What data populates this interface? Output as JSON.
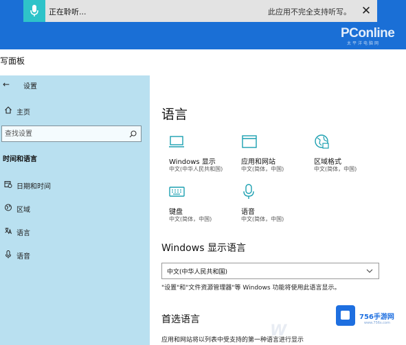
{
  "dictation": {
    "status": "正在聆听...",
    "notice": "此应用不完全支持听写。",
    "close_symbol": "✕"
  },
  "watermark": {
    "logo": "PConline",
    "logo_sub": "太平洋电脑网",
    "site": "756手游网",
    "site_sub": "www.756s.com"
  },
  "handwriting_panel_title": "写面板",
  "sidebar": {
    "back_symbol": "←",
    "title": "设置",
    "home_label": "主页",
    "search_placeholder": "查找设置",
    "section_heading": "时间和语言",
    "items": [
      {
        "label": "日期和时间",
        "icon": "calendar-clock-icon"
      },
      {
        "label": "区域",
        "icon": "globe-icon"
      },
      {
        "label": "语言",
        "icon": "language-icon"
      },
      {
        "label": "语音",
        "icon": "microphone-icon"
      }
    ]
  },
  "content": {
    "page_title": "语言",
    "tiles": [
      {
        "title": "Windows 显示",
        "subtitle": "中文(中华人民共和国)",
        "icon": "monitor-icon"
      },
      {
        "title": "应用和网站",
        "subtitle": "中文(简体，中国)",
        "icon": "window-icon"
      },
      {
        "title": "区域格式",
        "subtitle": "中文(简体，中国)",
        "icon": "globe-format-icon"
      },
      {
        "title": "键盘",
        "subtitle": "中文(简体，中国)",
        "icon": "keyboard-icon"
      },
      {
        "title": "语音",
        "subtitle": "中文(简体，中国)",
        "icon": "microphone-icon"
      }
    ],
    "display_language_heading": "Windows 显示语言",
    "display_language_value": "中文(中华人民共和国)",
    "display_language_hint": "\"设置\"和\"文件资源管理器\"等 Windows 功能将使用此语言显示。",
    "preferred_heading": "首选语言",
    "preferred_desc": "应用和网站将以列表中受支持的第一种语言进行显示"
  },
  "colors": {
    "top_band": "#1a6fd6",
    "sidebar_bg": "#b9e0f0",
    "accent_teal": "#1a9fb0"
  }
}
